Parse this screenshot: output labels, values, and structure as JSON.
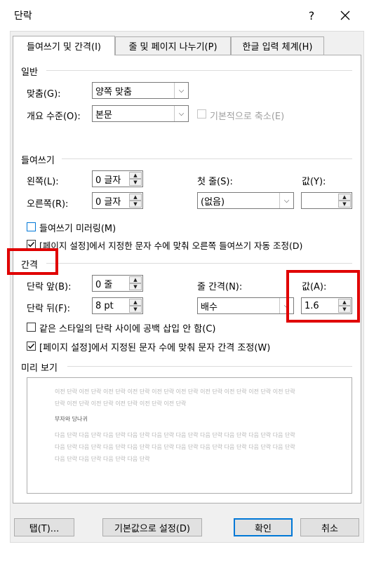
{
  "window": {
    "title": "단락",
    "help": "?",
    "close": "✕"
  },
  "tabs": [
    {
      "label": "들여쓰기 및 간격(I)",
      "mn": "I"
    },
    {
      "label": "줄 및 페이지 나누기(P)",
      "mn": "P"
    },
    {
      "label": "한글 입력 체계(H)",
      "mn": "H"
    }
  ],
  "general": {
    "section": "일반",
    "alignment_label": "맞춤(G):",
    "alignment_value": "양쪽 맞춤",
    "outline_label": "개요 수준(O):",
    "outline_value": "본문",
    "collapse_label": "기본적으로 축소(E)"
  },
  "indent": {
    "section": "들여쓰기",
    "left_label": "왼쪽(L):",
    "left_value": "0 글자",
    "right_label": "오른쪽(R):",
    "right_value": "0 글자",
    "first_label": "첫 줄(S):",
    "first_value": "(없음)",
    "by_label": "값(Y):",
    "by_value": "",
    "mirror_label": "들여쓰기 미러링(M)",
    "auto_label": "[페이지 설정]에서 지정한 문자 수에 맞춰 오른쪽 들여쓰기 자동 조정(D)"
  },
  "spacing": {
    "section": "간격",
    "before_label": "단락 앞(B):",
    "before_value": "0 줄",
    "after_label": "단락 뒤(F):",
    "after_value": "8 pt",
    "line_label": "줄 간격(N):",
    "line_value": "배수",
    "at_label": "값(A):",
    "at_value": "1.6",
    "nospace_label": "같은 스타일의 단락 사이에 공백 삽입 안 함(C)",
    "grid_label": "[페이지 설정]에서 지정된 문자 수에 맞춰 문자 간격 조정(W)"
  },
  "preview": {
    "section": "미리 보기",
    "prev1": "이전 단락 이전 단락 이전 단락 이전 단락 이전 단락 이전 단락 이전 단락 이전 단락 이전 단락 이전 단락",
    "prev2": "단락 이전 단락 이전 단락 이전 단락 이전 단락 이전 단락",
    "current": "부자와 당나귀",
    "next1": "다음 단락 다음 단락 다음 단락 다음 단락 다음 단락 다음 단락 다음 단락 다음 단락 다음 단락 다음 단락",
    "next2": "다음 단락 다음 단락 다음 단락 다음 단락 다음 단락 다음 단락 다음 단락 다음 단락 다음 단락 다음 단락",
    "next3": "다음 단락 다음 단락 다음 단락 다음 단락"
  },
  "buttons": {
    "tabs": "탭(T)...",
    "default": "기본값으로 설정(D)",
    "ok": "확인",
    "cancel": "취소"
  },
  "colors": {
    "highlight": "#e00000",
    "focus": "#0078d7"
  }
}
